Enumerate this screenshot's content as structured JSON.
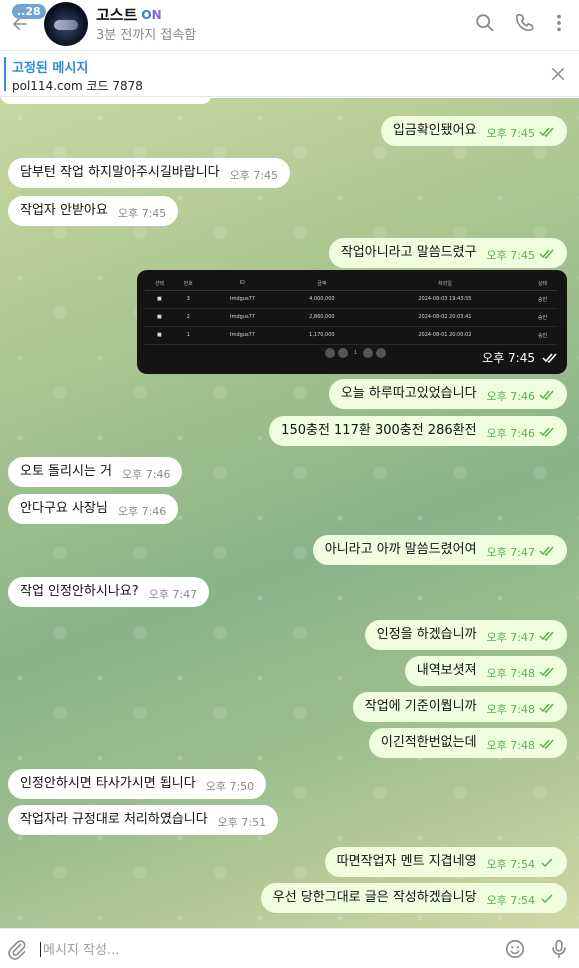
{
  "header": {
    "badge": "..28",
    "title": "고스트",
    "on_label_a": "O",
    "on_label_b": "N",
    "status": "3분 전까지 접속함"
  },
  "pinned": {
    "title": "고정된 메시지",
    "text": "pol114.com 코드 7878"
  },
  "messages": [
    {
      "dir": "out",
      "text": "입금확인됐어요",
      "time": "오후 7:45",
      "read": true
    },
    {
      "dir": "in",
      "text": "담부턴 작업 하지말아주시길바랍니다",
      "time": "오후 7:45"
    },
    {
      "dir": "in",
      "text": "작업자 안받아요",
      "time": "오후 7:45"
    },
    {
      "dir": "out",
      "text": "작업아니라고 말씀드렸구",
      "time": "오후 7:45",
      "read": true
    },
    {
      "dir": "out",
      "text": "오늘 하루따고있었습니다",
      "time": "오후 7:46",
      "read": true
    },
    {
      "dir": "out",
      "text": "150충전 117환 300충전 286환전",
      "time": "오후 7:46",
      "read": true
    },
    {
      "dir": "in",
      "text": "오토 돌리시는 거",
      "time": "오후 7:46"
    },
    {
      "dir": "in",
      "text": "안다구요 사장님",
      "time": "오후 7:46"
    },
    {
      "dir": "out",
      "text": "아니라고 아까 말씀드렸어여",
      "time": "오후 7:47",
      "read": true
    },
    {
      "dir": "in",
      "text": "작업 인정안하시나요?",
      "time": "오후 7:47"
    },
    {
      "dir": "out",
      "text": "인정을 하겠습니까",
      "time": "오후 7:47",
      "read": true
    },
    {
      "dir": "out",
      "text": "내역보셧져",
      "time": "오후 7:48",
      "read": true
    },
    {
      "dir": "out",
      "text": "작업에 기준이뭡니까",
      "time": "오후 7:48",
      "read": true
    },
    {
      "dir": "out",
      "text": "이긴적한번없는데",
      "time": "오후 7:48",
      "read": true
    },
    {
      "dir": "in",
      "text": "인정안하시면 타사가시면 됩니다",
      "time": "오후 7:50"
    },
    {
      "dir": "in",
      "text": "작업자라 규정대로 처리하였습니다",
      "time": "오후 7:51"
    },
    {
      "dir": "out",
      "text": "따면작업자 멘트 지겹네영",
      "time": "오후 7:54",
      "read": false
    },
    {
      "dir": "out",
      "text": "우선 당한그대로 글은 작성하겠습니당",
      "time": "오후 7:54",
      "read": false
    }
  ],
  "image_message": {
    "time": "오후 7:45",
    "columns": [
      "선택",
      "번호",
      "ID",
      "금액",
      "처리일",
      "상태"
    ],
    "rows": [
      [
        "■",
        "3",
        "tmdgus77",
        "4,000,000",
        "2024-08-03 19:43:55",
        "승인"
      ],
      [
        "■",
        "2",
        "tmdgus77",
        "2,860,000",
        "2024-08-02 20:03:41",
        "승인"
      ],
      [
        "■",
        "1",
        "tmdgus77",
        "1,170,000",
        "2024-08-01 20:00:02",
        "승인"
      ]
    ],
    "page": "1"
  },
  "input": {
    "placeholder": "메시지 작성..."
  },
  "colors": {
    "accent": "#3a8fd8",
    "out_bubble": "#eefedf",
    "read_check": "#5fae55"
  },
  "icons": [
    "back-arrow-icon",
    "search-icon",
    "phone-icon",
    "more-icon",
    "close-icon",
    "paperclip-icon",
    "emoji-icon",
    "microphone-icon",
    "double-check-icon",
    "check-icon"
  ]
}
